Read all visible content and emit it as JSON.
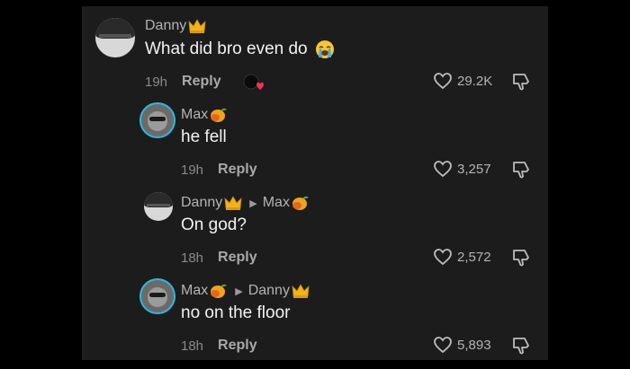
{
  "comments": [
    {
      "user": "Danny",
      "user_badge": "crown",
      "text": "What did bro even do",
      "text_emoji": "crying-face",
      "time": "19h",
      "reply": "Reply",
      "likes": "29.2K"
    },
    {
      "user": "Max",
      "user_badge": "mango",
      "text": "he fell",
      "time": "19h",
      "reply": "Reply",
      "likes": "3,257"
    },
    {
      "user": "Danny",
      "user_badge": "crown",
      "reply_to": "Max",
      "reply_to_badge": "mango",
      "text": "On god?",
      "time": "18h",
      "reply": "Reply",
      "likes": "2,572"
    },
    {
      "user": "Max",
      "user_badge": "mango",
      "reply_to": "Danny",
      "reply_to_badge": "crown",
      "text": "no on the floor",
      "time": "18h",
      "reply": "Reply",
      "likes": "5,893"
    }
  ],
  "colors": {
    "panel": "#1c1c1c",
    "accent_ring": "#2fb8e0",
    "liked_heart": "#fe2c55"
  }
}
